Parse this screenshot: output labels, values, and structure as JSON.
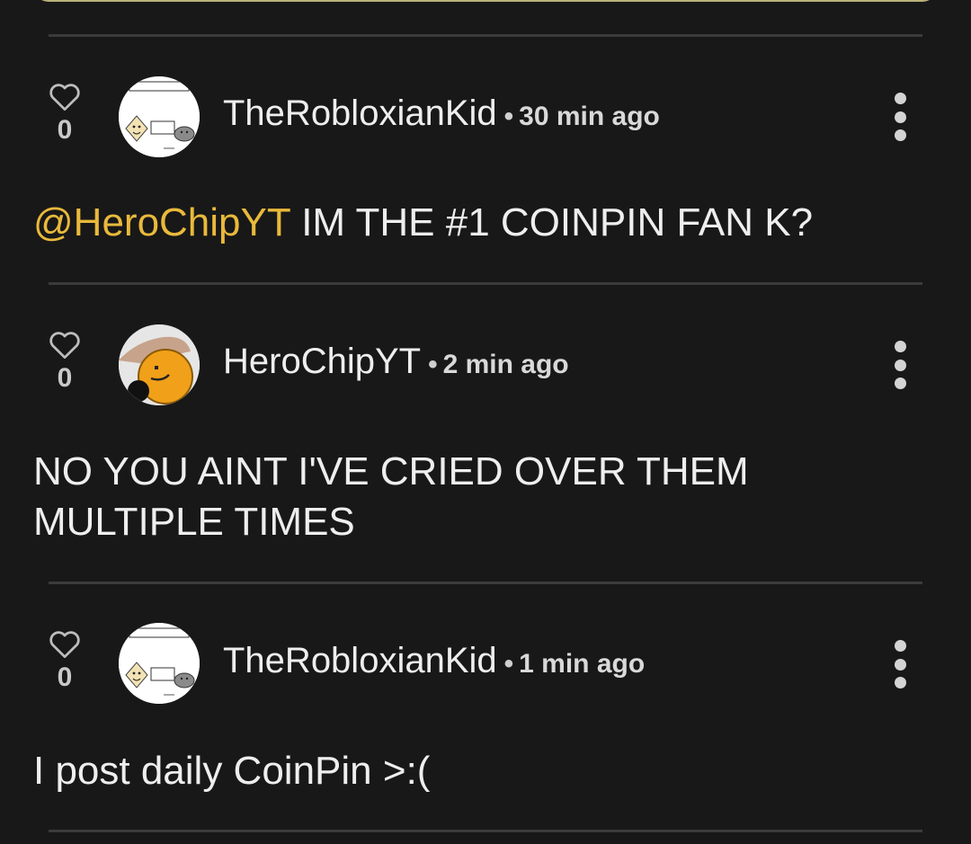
{
  "comments": [
    {
      "likes": "0",
      "username": "TheRobloxianKid",
      "separator": "•",
      "time": "30 min ago",
      "mention": "@HeroChipYT",
      "text": " IM THE #1 COINPIN FAN K?"
    },
    {
      "likes": "0",
      "username": "HeroChipYT",
      "separator": "•",
      "time": "2 min ago",
      "mention": "",
      "text": "NO YOU AINT I'VE CRIED OVER THEM MULTIPLE TIMES"
    },
    {
      "likes": "0",
      "username": "TheRobloxianKid",
      "separator": "•",
      "time": "1 min ago",
      "mention": "",
      "text": "I post daily CoinPin >:("
    }
  ],
  "colors": {
    "background": "#181818",
    "mention": "#e9b93b",
    "divider": "#3b3b3b",
    "text": "#eeeeee"
  },
  "icons": {
    "like": "heart-outline-icon",
    "menu": "more-vertical-icon"
  }
}
